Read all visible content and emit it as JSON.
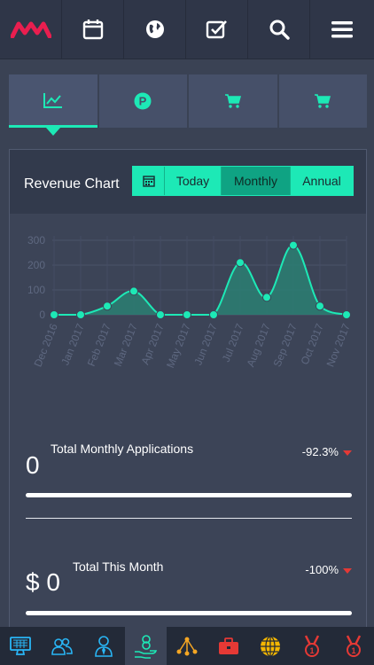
{
  "colors": {
    "accent": "#1de9b6",
    "brand": "#e91e4f",
    "background": "#3a4254",
    "negative": "#e53935"
  },
  "topbar": {
    "icons": [
      "brand-logo",
      "calendar-icon",
      "globe-icon",
      "checkbox-icon",
      "search-icon",
      "menu-icon"
    ]
  },
  "tabs": {
    "icons": [
      "trend-chart-icon",
      "parking-icon",
      "cart-icon",
      "cart-icon"
    ],
    "active": 0
  },
  "revenue": {
    "title": "Revenue Chart",
    "buttons": {
      "today": "Today",
      "monthly": "Monthly",
      "annual": "Annual"
    },
    "selected": "Monthly"
  },
  "chart_data": {
    "type": "area",
    "x": [
      "Dec 2016",
      "Jan 2017",
      "Feb 2017",
      "Mar 2017",
      "Apr 2017",
      "May 2017",
      "Jun 2017",
      "Jul 2017",
      "Aug 2017",
      "Sep 2017",
      "Oct 2017",
      "Nov 2017"
    ],
    "values": [
      0,
      0,
      35,
      95,
      0,
      0,
      0,
      210,
      70,
      280,
      35,
      0
    ],
    "yticks": [
      "0",
      "100",
      "200",
      "300"
    ],
    "ylim": [
      0,
      300
    ],
    "grid": true,
    "line_color": "#1de9b6",
    "fill_color": "#2a7f72"
  },
  "stats": [
    {
      "label": "Total Monthly Applications",
      "value": "0",
      "change": "-92.3%",
      "progress": 1.0
    },
    {
      "label": "Total This Month",
      "value": "$ 0",
      "change": "-100%",
      "progress": 1.0
    }
  ],
  "bottombar": {
    "icons": [
      "monitor-icon",
      "users-icon",
      "user-tie-icon",
      "money-hand-icon",
      "network-icon",
      "briefcase-icon",
      "globe-grid-icon",
      "medal-icon",
      "medal-icon"
    ],
    "active": 3
  }
}
